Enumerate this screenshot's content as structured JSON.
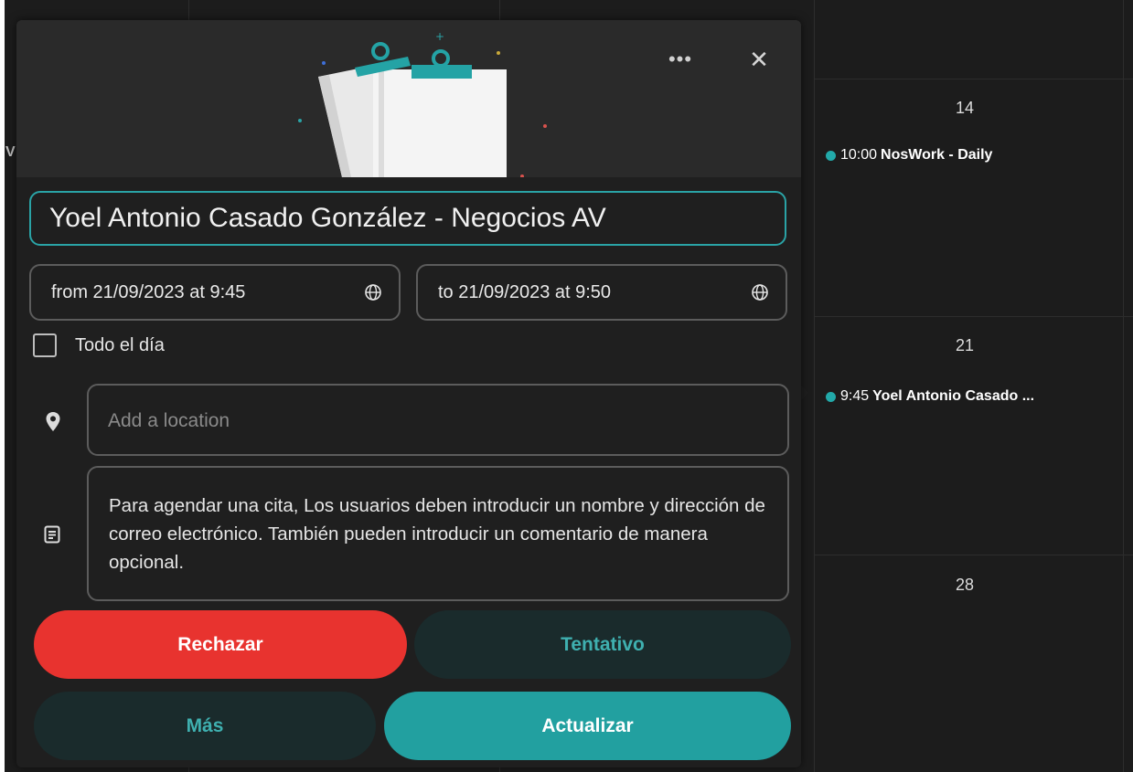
{
  "colors": {
    "accent": "#2aa3a6",
    "event_dot": "#22a9a9",
    "reject": "#e8332f",
    "update": "#22a0a0",
    "secondary_bg": "#1a2b2c",
    "secondary_text": "#3fb0b0"
  },
  "calendar": {
    "days": [
      "14",
      "21",
      "28"
    ],
    "events": [
      {
        "time": "10:00",
        "title": "NosWork - Daily"
      },
      {
        "time": "9:45",
        "title": "Yoel Antonio Casado ..."
      }
    ],
    "stray_text": "V"
  },
  "popup": {
    "more_label": "•••",
    "close_label": "✕",
    "title_value": "Yoel Antonio Casado González - Negocios AV",
    "from_label": "from 21/09/2023 at 9:45",
    "to_label": "to 21/09/2023 at 9:50",
    "all_day_label": "Todo el día",
    "location_placeholder": "Add a location",
    "description": "Para agendar una cita, Los usuarios deben introducir un nombre y dirección de correo electrónico. También pueden introducir un comentario de manera opcional.",
    "buttons": {
      "reject": "Rechazar",
      "tentative": "Tentativo",
      "more": "Más",
      "update": "Actualizar"
    },
    "icons": {
      "more": "more-horizontal-icon",
      "close": "close-icon",
      "globe": "globe-icon",
      "location": "location-pin-icon",
      "notes": "notes-icon"
    }
  }
}
